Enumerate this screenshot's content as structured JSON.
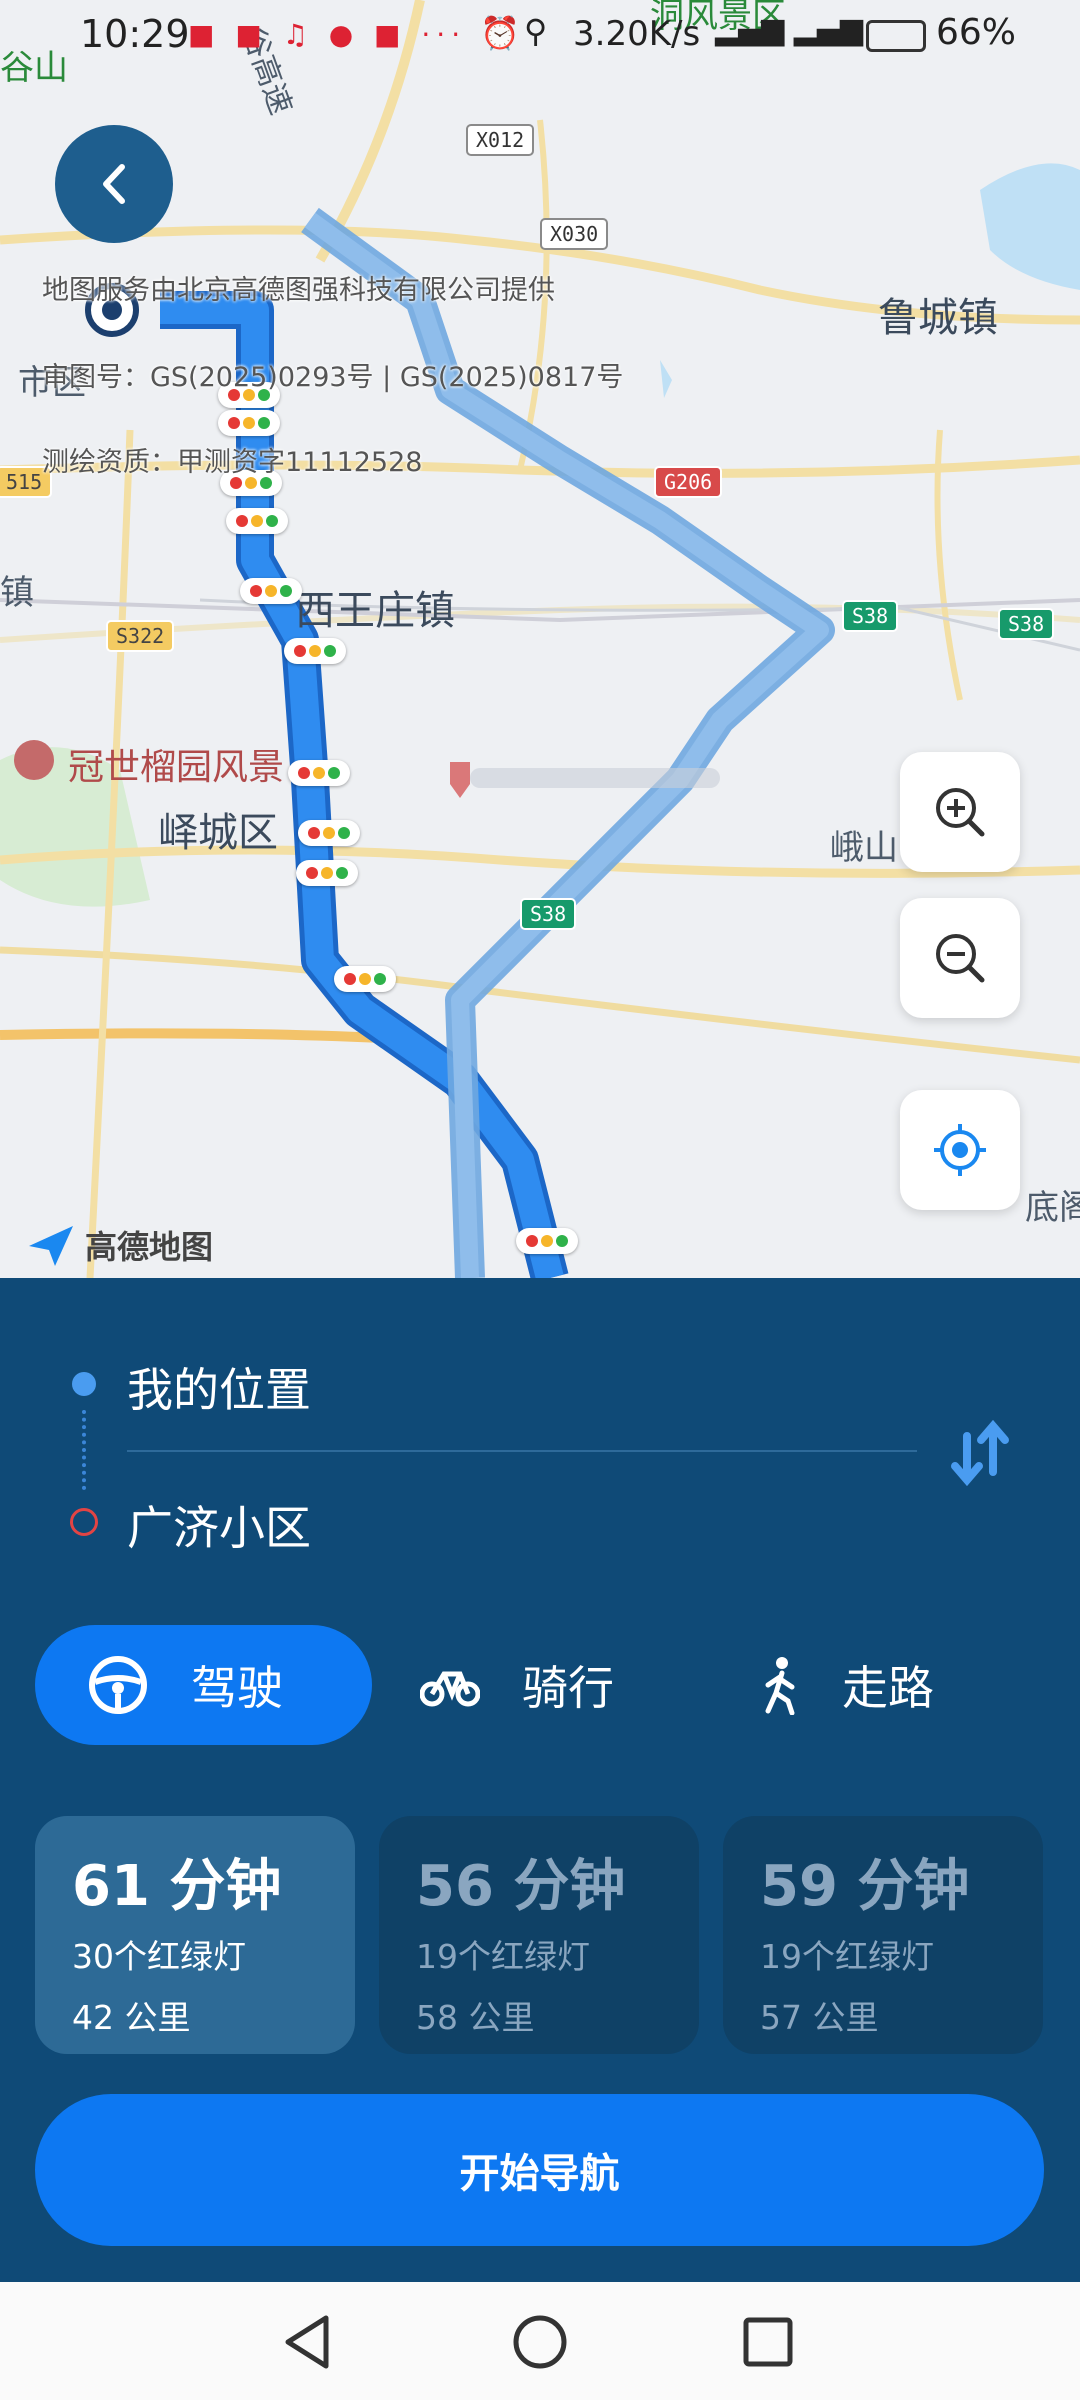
{
  "status_bar": {
    "time": "10:29",
    "net_speed": "3.20K/s",
    "battery": "66%"
  },
  "map": {
    "labels": {
      "gugu": "谷山",
      "highway": "谷高速",
      "scenic": "洞风景区",
      "lucheng": "鲁城镇",
      "xiwangzhuang": "西王庄镇",
      "guanshi": "冠世榴园风景",
      "yicheng": "峄城区",
      "eshan": "峨山",
      "di": "底阁",
      "zhen_left": "镇",
      "shi": "市区"
    },
    "shields": {
      "x012": "X012",
      "x030": "X030",
      "g206": "G206",
      "s38a": "S38",
      "s38b": "S38",
      "s38c": "S38",
      "s322": "S322",
      "n515": "515"
    },
    "copyright": {
      "provider": "地图服务由北京高德图强科技有限公司提供",
      "review_no": "审图号：GS(2025)0293号 | GS(2025)0817号",
      "survey": "测绘资质：甲测资字11112528"
    },
    "logo_text": "高德地图"
  },
  "route": {
    "origin": "我的位置",
    "destination": "广济小区"
  },
  "modes": [
    {
      "label": "驾驶",
      "active": true
    },
    {
      "label": "骑行",
      "active": false
    },
    {
      "label": "走路",
      "active": false
    }
  ],
  "options": [
    {
      "time": "61 分钟",
      "lights": "30个红绿灯",
      "distance": "42 公里",
      "selected": true
    },
    {
      "time": "56 分钟",
      "lights": "19个红绿灯",
      "distance": "58 公里",
      "selected": false
    },
    {
      "time": "59 分钟",
      "lights": "19个红绿灯",
      "distance": "57 公里",
      "selected": false
    }
  ],
  "start_button": "开始导航",
  "colors": {
    "panel_bg": "#0f4a77",
    "accent_blue": "#0d78f2",
    "route_blue": "#2f8cf0"
  }
}
